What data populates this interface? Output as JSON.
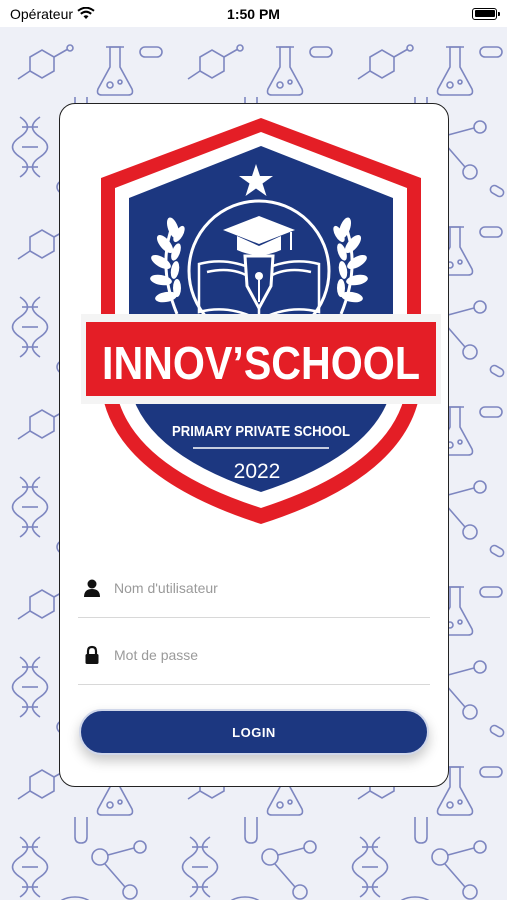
{
  "status_bar": {
    "carrier": "Opérateur",
    "time": "1:50 PM",
    "wifi_icon": "wifi-icon",
    "battery_icon": "battery-icon"
  },
  "logo": {
    "name": "INNOV’SCHOOL",
    "subtitle": "PRIMARY PRIVATE SCHOOL",
    "year": "2022",
    "colors": {
      "red": "#e41e26",
      "navy": "#1c3780",
      "white": "#ffffff"
    }
  },
  "form": {
    "username": {
      "placeholder": "Nom d'utilisateur",
      "value": "",
      "icon": "user-icon"
    },
    "password": {
      "placeholder": "Mot de passe",
      "value": "",
      "icon": "lock-icon"
    },
    "login_label": "LOGIN"
  },
  "theme": {
    "background": "#eef0f7",
    "pattern": "#4d5aa8",
    "button": "#1c3780"
  }
}
